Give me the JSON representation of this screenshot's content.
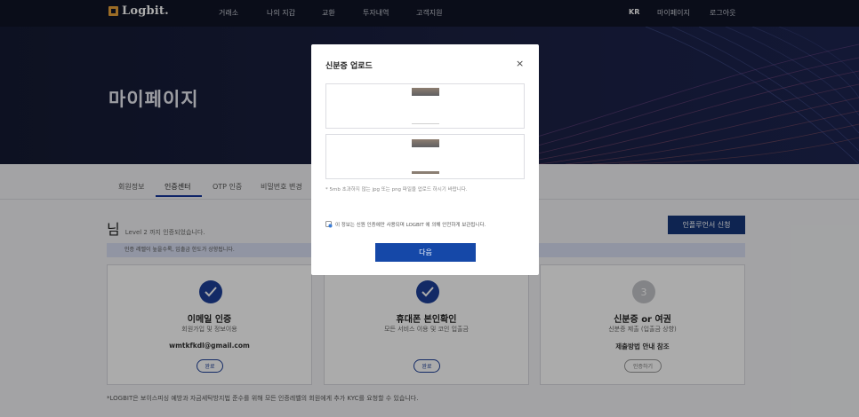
{
  "nav": {
    "brand": "Logbit.",
    "menu": [
      "거래소",
      "나의 지갑",
      "교환",
      "투자내역",
      "고객지원"
    ],
    "lang": "KR",
    "mypage": "마이페이지",
    "logout": "로그아웃"
  },
  "hero": {
    "title": "마이페이지"
  },
  "tabs": [
    "회원정보",
    "인증센터",
    "OTP 인증",
    "비밀번호 변경"
  ],
  "main": {
    "nim": "님",
    "level_text": "Level 2 까지 인증되었습니다.",
    "apply_button": "인플루언서 신청",
    "info_text": "인증 레벨이 높을수록, 입출금 한도가 상향됩니다."
  },
  "cards": [
    {
      "title": "이메일 인증",
      "subtitle": "회원가입 및 정보이용",
      "value": "wmtkfkdl@gmail.com",
      "button": "완료"
    },
    {
      "title": "휴대폰 본인확인",
      "subtitle": "모든 서비스 이용 및 코인 입출금",
      "button": "완료"
    },
    {
      "number": "3",
      "title": "신분증 or 여권",
      "subtitle": "신분증 제출 (입출금 상향)",
      "value": "제출방법 안내 참조",
      "button": "인증하기"
    }
  ],
  "footnote": "*LOGBIT은 보이스피싱 예방과 자금세탁방지법 준수를 위해 모든 인증레벨의 회원에게 추가 KYC를 요청할 수 있습니다.",
  "modal": {
    "title": "신분증 업로드",
    "close": "×",
    "hint": "* 5mb 초과하지 않는 jpg 또는 png 파일을 업로드 하시기 바랍니다.",
    "note": "이 정보는 신원 인증에만 사용되며 LOGBIT 에 의해 안전하게 보관됩니다.",
    "next_button": "다음"
  },
  "colors": {
    "primary": "#16367a",
    "nav_bg": "#0f1426",
    "accent": "#e8a23a"
  }
}
